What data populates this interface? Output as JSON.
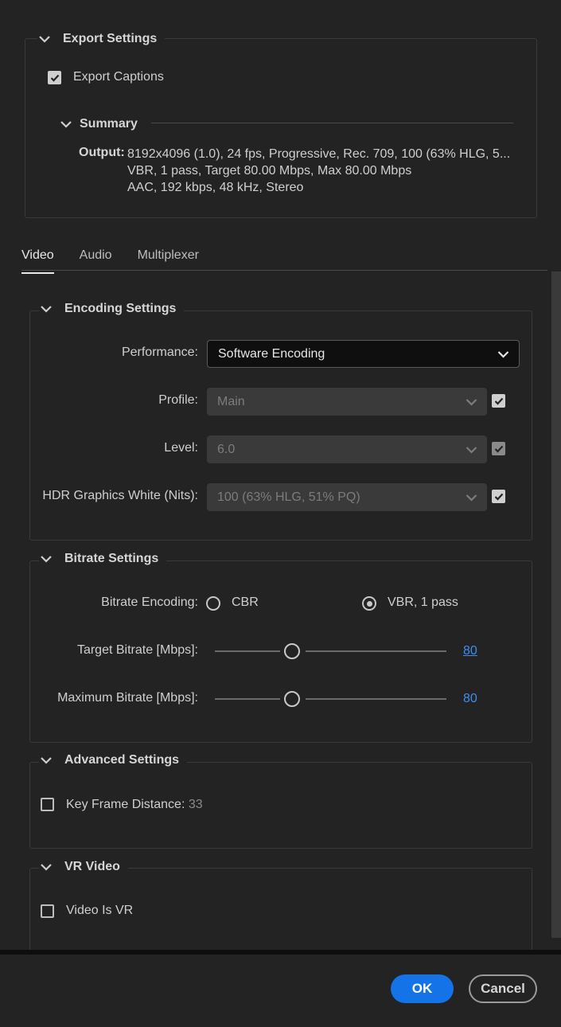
{
  "export_settings": {
    "title": "Export Settings",
    "export_captions_label": "Export Captions",
    "export_captions_checked": true,
    "summary": {
      "title": "Summary",
      "output_label": "Output:",
      "output_lines": [
        "8192x4096 (1.0), 24 fps, Progressive, Rec. 709, 100 (63% HLG, 5...",
        "VBR, 1 pass, Target 80.00 Mbps, Max 80.00 Mbps",
        "AAC, 192 kbps, 48 kHz, Stereo"
      ]
    }
  },
  "tabs": [
    {
      "label": "Video",
      "active": true
    },
    {
      "label": "Audio",
      "active": false
    },
    {
      "label": "Multiplexer",
      "active": false
    }
  ],
  "encoding": {
    "title": "Encoding Settings",
    "performance_label": "Performance:",
    "performance_value": "Software Encoding",
    "profile_label": "Profile:",
    "profile_value": "Main",
    "level_label": "Level:",
    "level_value": "6.0",
    "hdr_label": "HDR Graphics White (Nits):",
    "hdr_value": "100 (63% HLG, 51% PQ)"
  },
  "bitrate": {
    "title": "Bitrate Settings",
    "encoding_label": "Bitrate Encoding:",
    "option_cbr": "CBR",
    "option_vbr": "VBR, 1 pass",
    "selected": "VBR, 1 pass",
    "target_label": "Target Bitrate [Mbps]:",
    "target_value": "80",
    "max_label": "Maximum Bitrate [Mbps]:",
    "max_value": "80",
    "slider_fraction": 0.33
  },
  "advanced": {
    "title": "Advanced Settings",
    "keyframe_label": "Key Frame Distance:",
    "keyframe_value": "33",
    "keyframe_checked": false
  },
  "vr": {
    "title": "VR Video",
    "vr_label": "Video Is VR",
    "vr_checked": false
  },
  "footer": {
    "ok_label": "OK",
    "cancel_label": "Cancel"
  },
  "colors": {
    "accent": "#1473e6",
    "link": "#3d8ef0",
    "background": "#232323"
  }
}
